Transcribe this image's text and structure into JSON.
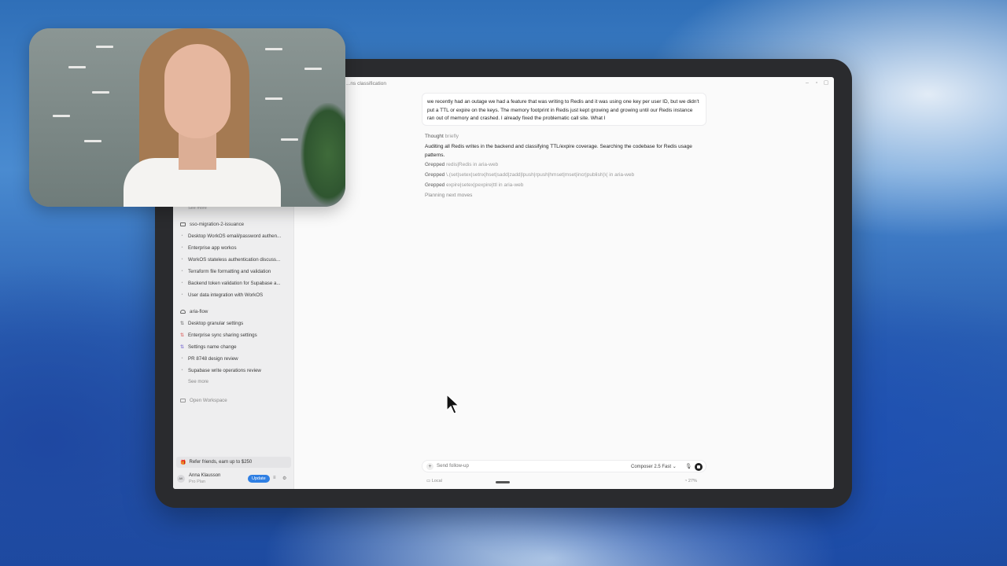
{
  "titlebar": {
    "title": "...ns classification"
  },
  "conversation": {
    "user_message": "we recently had an outage we had a feature that was writing to Redis and it was using one key per user ID, but we didn't put a TTL or expire on the keys. The memory footprint in Redis just kept growing and growing until our Redis instance ran out of memory and crashed. I already fixed the problematic call site. What I",
    "thought_label": "Thought",
    "thought_detail": "briefly",
    "status_text": "Auditing all Redis writes in the backend and classifying TTL/expire coverage. Searching the codebase for Redis usage patterns.",
    "grepped": [
      {
        "label": "Grepped",
        "query": "redis|Redis in aria-web"
      },
      {
        "label": "Grepped",
        "query": "\\.(set|setex|setnx|hset|sadd|zadd|lpush|rpush|hmset|mset|incr|publish)\\( in aria-web"
      },
      {
        "label": "Grepped",
        "query": "expire|setex|pexpire|ttl in aria-web"
      }
    ],
    "planning": "Planning next moves"
  },
  "sidebar": {
    "truncated_top": "See more",
    "project1": {
      "name": "sso-migration-2-issuance"
    },
    "project1_items": [
      "Desktop WorkOS email/password authen...",
      "Enterprise app workos",
      "WorkOS stateless authentication discuss...",
      "Terraform file formatting and validation",
      "Backend token validation for Supabase a...",
      "User data integration with WorkOS"
    ],
    "project2": {
      "name": "aria-flow"
    },
    "project2_items": [
      "Desktop granular settings",
      "Enterprise sync sharing settings",
      "Settings name change",
      "PR 8748 design review",
      "Supabase write operations review"
    ],
    "see_more": "See more",
    "open_workspace": "Open Workspace",
    "refer": "Refer friends, earn up to $250",
    "user": {
      "initials": "AK",
      "name": "Anna Klausson",
      "plan": "Pro Plan",
      "update_label": "Update"
    }
  },
  "composer": {
    "placeholder": "Send follow-up",
    "model": "Composer 2.5 Fast",
    "local_label": "Local",
    "context_pct": "27%"
  },
  "colors": {
    "accent": "#2f7fe3",
    "desktop_blue": "#2a5fb2"
  },
  "icons": [
    "folder-icon",
    "cloud-icon",
    "plus-icon",
    "mic-icon",
    "stop-icon",
    "gift-icon",
    "mouse-cursor-icon"
  ]
}
